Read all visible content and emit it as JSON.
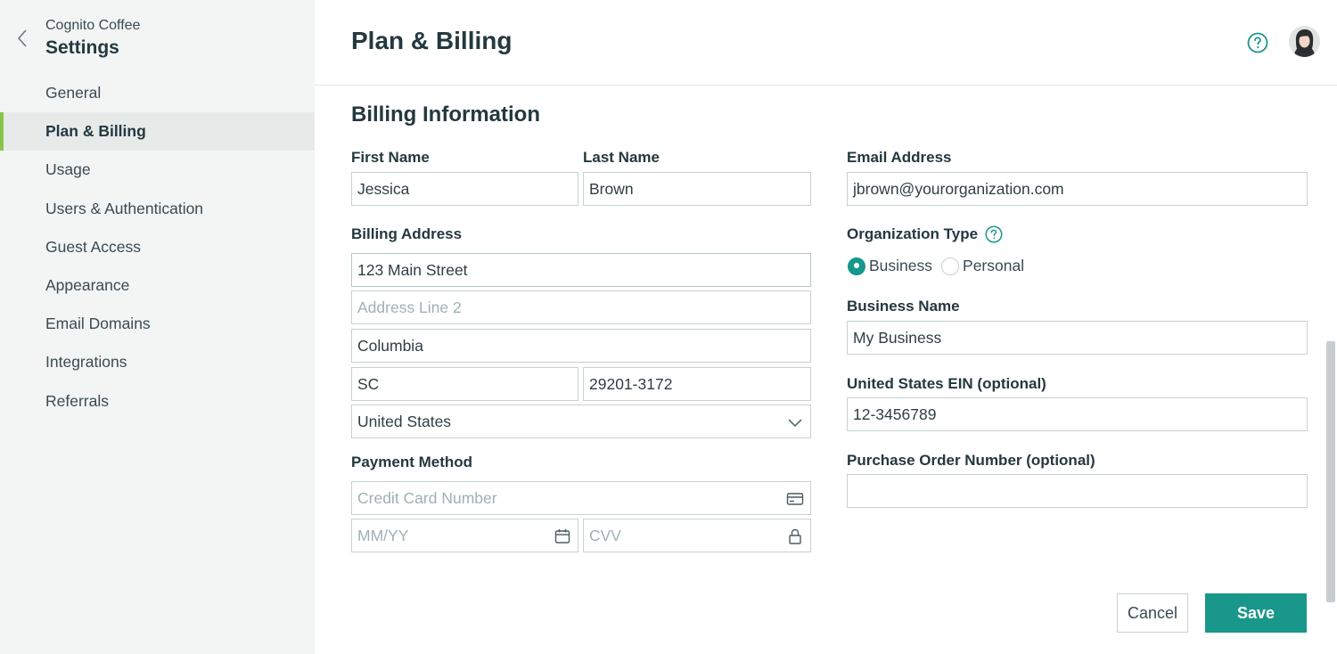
{
  "sidebar": {
    "org_name": "Cognito Coffee",
    "title": "Settings",
    "items": [
      {
        "label": "General"
      },
      {
        "label": "Plan & Billing",
        "active": true
      },
      {
        "label": "Usage"
      },
      {
        "label": "Users & Authentication"
      },
      {
        "label": "Guest Access"
      },
      {
        "label": "Appearance"
      },
      {
        "label": "Email Domains"
      },
      {
        "label": "Integrations"
      },
      {
        "label": "Referrals"
      }
    ]
  },
  "header": {
    "title": "Plan & Billing",
    "help_icon": "question-circle-icon",
    "avatar_icon": "user-avatar"
  },
  "billing": {
    "section_title": "Billing Information",
    "first_name_label": "First Name",
    "first_name_value": "Jessica",
    "last_name_label": "Last Name",
    "last_name_value": "Brown",
    "billing_address_label": "Billing Address",
    "address_line1_value": "123 Main Street",
    "address_line2_placeholder": "Address Line 2",
    "city_value": "Columbia",
    "state_value": "SC",
    "zip_value": "29201-3172",
    "country_value": "United States",
    "payment_method_label": "Payment Method",
    "card_number_placeholder": "Credit Card Number",
    "expiry_placeholder": "MM/YY",
    "cvv_placeholder": "CVV",
    "email_label": "Email Address",
    "email_value": "jbrown@yourorganization.com",
    "org_type_label": "Organization Type",
    "org_type_options": [
      "Business",
      "Personal"
    ],
    "org_type_selected": "Business",
    "business_name_label": "Business Name",
    "business_name_value": "My Business",
    "ein_label": "United States EIN (optional)",
    "ein_value": "12-3456789",
    "po_label": "Purchase Order Number (optional)",
    "po_value": ""
  },
  "actions": {
    "cancel_label": "Cancel",
    "save_label": "Save"
  },
  "colors": {
    "accent": "#1a978b",
    "active_indicator": "#8bc34a",
    "sidebar_bg": "#f3f5f5",
    "text_dark": "#24383f"
  }
}
